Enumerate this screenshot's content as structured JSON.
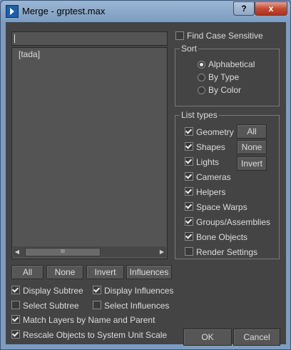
{
  "window": {
    "title": "Merge - grptest.max",
    "help_label": "?",
    "close_label": "x"
  },
  "filter": {
    "value": ""
  },
  "objects": {
    "items": [
      "[tada]"
    ],
    "scroll_thumb_grip": "III"
  },
  "options": {
    "find_case_sensitive": "Find Case Sensitive",
    "display_subtree": "Display Subtree",
    "display_influences": "Display Influences",
    "select_subtree": "Select Subtree",
    "select_influences": "Select Influences",
    "match_layers": "Match Layers by Name and Parent",
    "rescale": "Rescale Objects to System Unit Scale"
  },
  "sort": {
    "title": "Sort",
    "alphabetical": "Alphabetical",
    "by_type": "By Type",
    "by_color": "By Color",
    "selected": "Alphabetical"
  },
  "list_types": {
    "title": "List types",
    "items": [
      "Geometry",
      "Shapes",
      "Lights",
      "Cameras",
      "Helpers",
      "Space Warps",
      "Groups/Assemblies",
      "Bone Objects",
      "Render Settings"
    ],
    "all": "All",
    "none": "None",
    "invert": "Invert"
  },
  "bottom_buttons": {
    "all": "All",
    "none": "None",
    "invert": "Invert",
    "influences": "Influences"
  },
  "footer": {
    "ok": "OK",
    "cancel": "Cancel"
  }
}
